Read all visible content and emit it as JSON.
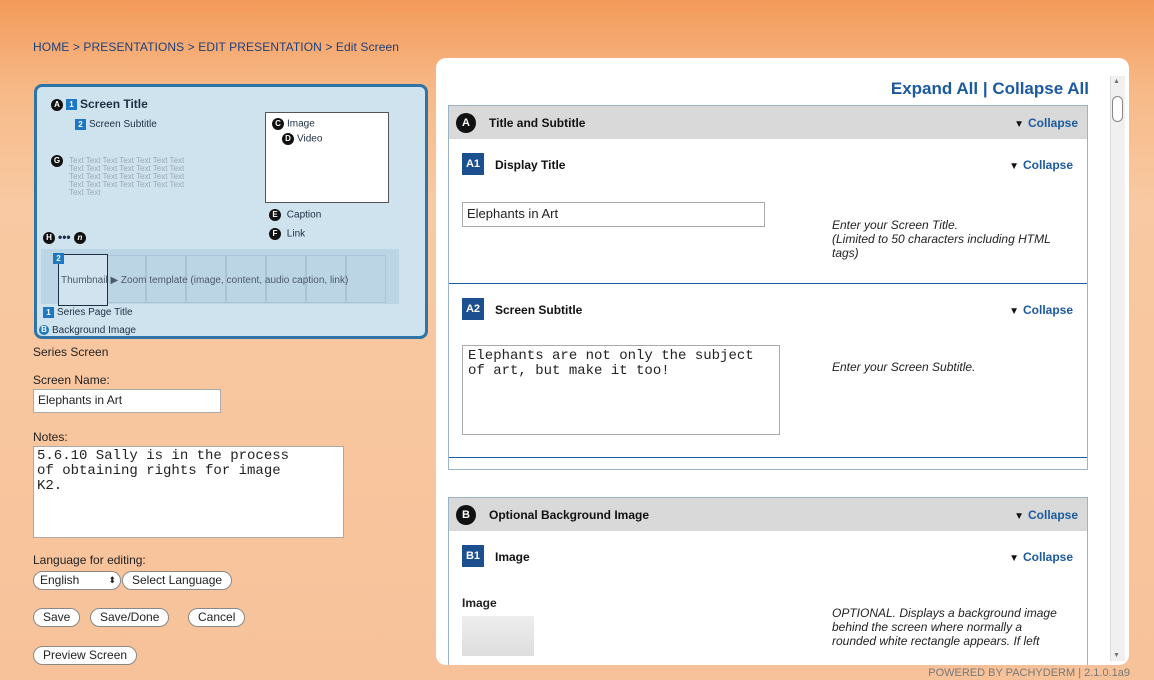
{
  "breadcrumb": "HOME > PRESENTATIONS > EDIT PRESENTATION > Edit Screen",
  "diagram": {
    "a": {
      "circle": "A",
      "sq": "1",
      "label": "Screen Title"
    },
    "a2": {
      "sq": "2",
      "label": "Screen Subtitle"
    },
    "c": {
      "circle": "C",
      "label": "Image"
    },
    "d": {
      "circle": "D",
      "label": "Video"
    },
    "g": {
      "circle": "G",
      "text": "Text Text Text Text Text Text Text Text Text Text Text Text Text Text Text Text Text Text Text Text Text Text Text Text Text Text Text Text Text Text"
    },
    "e": {
      "circle": "E",
      "label": "Caption"
    },
    "f": {
      "circle": "F",
      "label": "Link"
    },
    "h": {
      "circle_start": "H",
      "dots": "•••",
      "circle_end": "n"
    },
    "thumb_badge": "2",
    "thumb_text": "Thumbnail ▶ Zoom template (image, content, audio caption, link)",
    "series": {
      "sq": "1",
      "label": "Series Page Title"
    },
    "bg": {
      "circle": "B",
      "label": "Background Image"
    }
  },
  "form": {
    "series_screen": "Series Screen",
    "screen_name_label": "Screen Name:",
    "screen_name_value": "Elephants in Art",
    "notes_label": "Notes:",
    "notes_value": "5.6.10 Sally is in the process\nof obtaining rights for image\nK2.",
    "language_label": "Language for editing:",
    "language_value": "English",
    "select_language": "Select Language",
    "save": "Save",
    "save_done": "Save/Done",
    "cancel": "Cancel",
    "preview": "Preview Screen"
  },
  "panel": {
    "expand_all": "Expand All",
    "separator": "|",
    "collapse_all": "Collapse All",
    "collapse": "Collapse",
    "sectionA": {
      "badge": "A",
      "title": "Title and Subtitle",
      "a1": {
        "badge": "A1",
        "title": "Display Title",
        "value": "Elephants in Art",
        "hint": "Enter your Screen Title.\n(Limited to 50 characters including HTML tags)"
      },
      "a2": {
        "badge": "A2",
        "title": "Screen Subtitle",
        "value": "Elephants are not only the subject\nof art, but make it too!",
        "hint": "Enter your Screen Subtitle."
      }
    },
    "sectionB": {
      "badge": "B",
      "title": "Optional Background Image",
      "b1": {
        "badge": "B1",
        "title": "Image",
        "field_label": "Image",
        "hint": "OPTIONAL. Displays a background image behind the screen where normally a rounded white rectangle appears. If left"
      }
    }
  },
  "footer": "POWERED BY PACHYDERM | 2.1.0.1a9"
}
